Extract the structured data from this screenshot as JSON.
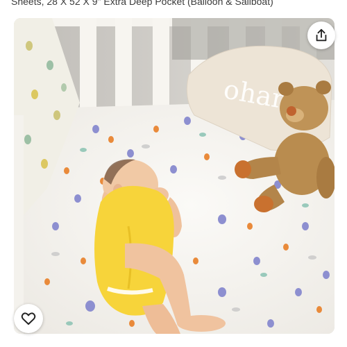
{
  "product": {
    "title": "Sheets, 28 X 52 X 9\" Extra Deep Pocket (Balloon & Sailboat)",
    "pillow_text": "ohana"
  },
  "actions": {
    "share_icon": "share-icon",
    "like_icon": "heart-icon"
  },
  "colors": {
    "onesie": "#f7d43a",
    "crib": "#f6f4ef",
    "sheet": "#f8f7f3",
    "teddy": "#b98c4f",
    "accent_balloon": "#8d8fd0"
  }
}
